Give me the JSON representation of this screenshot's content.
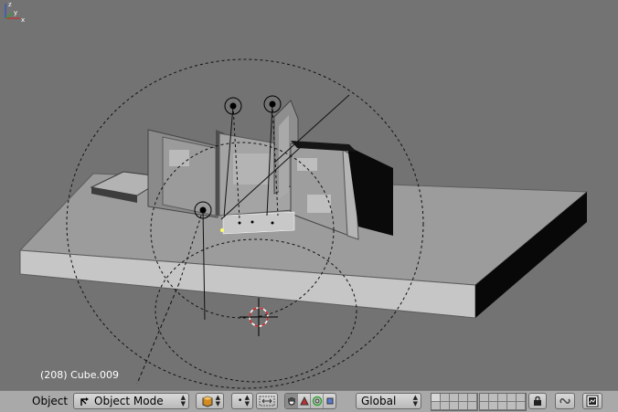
{
  "viewport": {
    "status_text": "(208) Cube.009",
    "axes": {
      "x": "x",
      "y": "y",
      "z": "z"
    }
  },
  "header": {
    "menu_label": "Object",
    "mode_select": {
      "value": "Object Mode",
      "icon": "mode-icon"
    },
    "draw_type": {
      "icon": "draw-type-icon"
    },
    "pivot": {
      "icon": "pivot-dot-icon"
    },
    "snap": {
      "icon": "snap-icon"
    },
    "manipulator": {
      "buttons": [
        "hand-icon",
        "translate-icon",
        "rotate-icon",
        "scale-icon"
      ],
      "active": 0
    },
    "orientation": {
      "value": "Global"
    },
    "layers": {
      "groups": 2,
      "active_layer": 1
    },
    "lock": {
      "icon": "lock-icon"
    },
    "link_button": {
      "icon": "link-icon"
    },
    "render_button": {
      "icon": "render-icon"
    }
  },
  "colors": {
    "viewport_bg": "#747474",
    "header_bg": "#a9a9a9",
    "text": "#ffffff",
    "lamp_dashes": "#111111",
    "cursor_red": "#cc2222",
    "axis_x": "#c03030",
    "axis_y": "#30a030",
    "axis_z": "#3050d0"
  }
}
